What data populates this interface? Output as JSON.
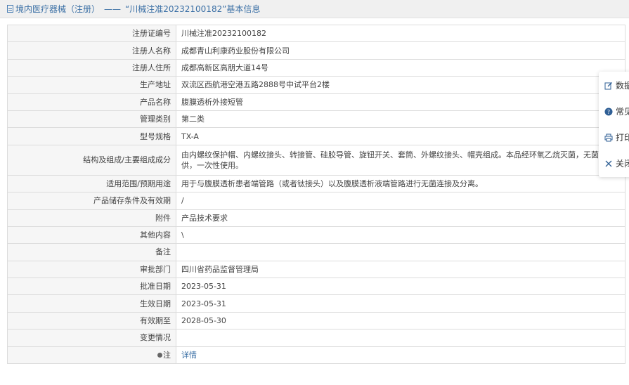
{
  "header": {
    "title": "境内医疗器械（注册）",
    "dash": "——",
    "heading": "“川械注准20232100182”基本信息"
  },
  "rows": [
    {
      "label": "注册证编号",
      "value": "川械注准20232100182"
    },
    {
      "label": "注册人名称",
      "value": "成都青山利康药业股份有限公司"
    },
    {
      "label": "注册人住所",
      "value": "成都高新区高朋大道14号"
    },
    {
      "label": "生产地址",
      "value": "双流区西航港空港五路2888号中试平台2楼"
    },
    {
      "label": "产品名称",
      "value": "腹膜透析外接短管"
    },
    {
      "label": "管理类别",
      "value": "第二类"
    },
    {
      "label": "型号规格",
      "value": "TX-A"
    },
    {
      "label": "结构及组成/主要组成成分",
      "value": "由内螺纹保护帽、内螺纹接头、转接管、硅胶导管、旋钮开关、套筒、外螺纹接头、帽壳组成。本品经环氧乙烷灭菌，无菌提供，一次性使用。"
    },
    {
      "label": "适用范围/预期用途",
      "value": "用于与腹膜透析患者端管路（或者钛接头）以及腹膜透析液端管路进行无菌连接及分离。"
    },
    {
      "label": "产品储存条件及有效期",
      "value": "/"
    },
    {
      "label": "附件",
      "value": "产品技术要求"
    },
    {
      "label": "其他内容",
      "value": "\\"
    },
    {
      "label": "备注",
      "value": ""
    },
    {
      "label": "审批部门",
      "value": "四川省药品监督管理局"
    },
    {
      "label": "批准日期",
      "value": "2023-05-31"
    },
    {
      "label": "生效日期",
      "value": "2023-05-31"
    },
    {
      "label": "有效期至",
      "value": "2028-05-30"
    },
    {
      "label": "变更情况",
      "value": ""
    }
  ],
  "note_row": {
    "label": "注",
    "link": "详情"
  },
  "float_menu": [
    {
      "icon": "edit-icon",
      "label": "数据"
    },
    {
      "icon": "help-icon",
      "label": "常见"
    },
    {
      "icon": "print-icon",
      "label": "打印"
    },
    {
      "icon": "close-icon",
      "label": "关闭"
    }
  ]
}
